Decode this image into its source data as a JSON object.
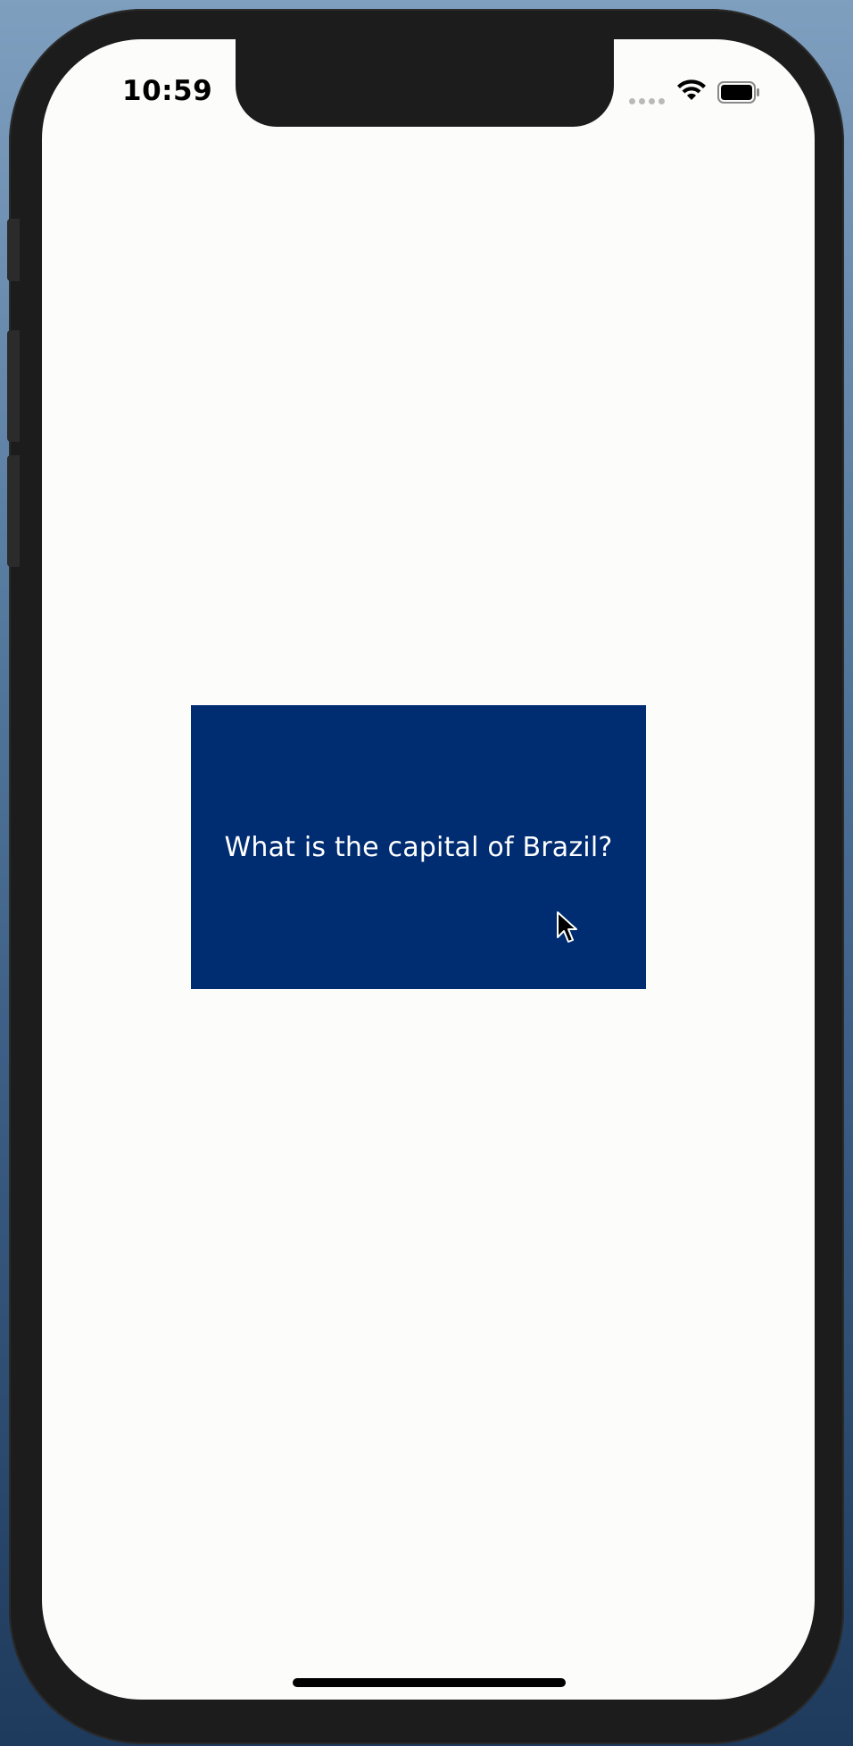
{
  "status_bar": {
    "time": "10:59",
    "icons": [
      "signal-dots-icon",
      "wifi-icon",
      "battery-icon"
    ]
  },
  "flashcard": {
    "question": "What is the capital of Brazil?",
    "background_color": "#002d72",
    "text_color": "#ffffff"
  },
  "screen": {
    "background_color": "#fcfcfb"
  }
}
